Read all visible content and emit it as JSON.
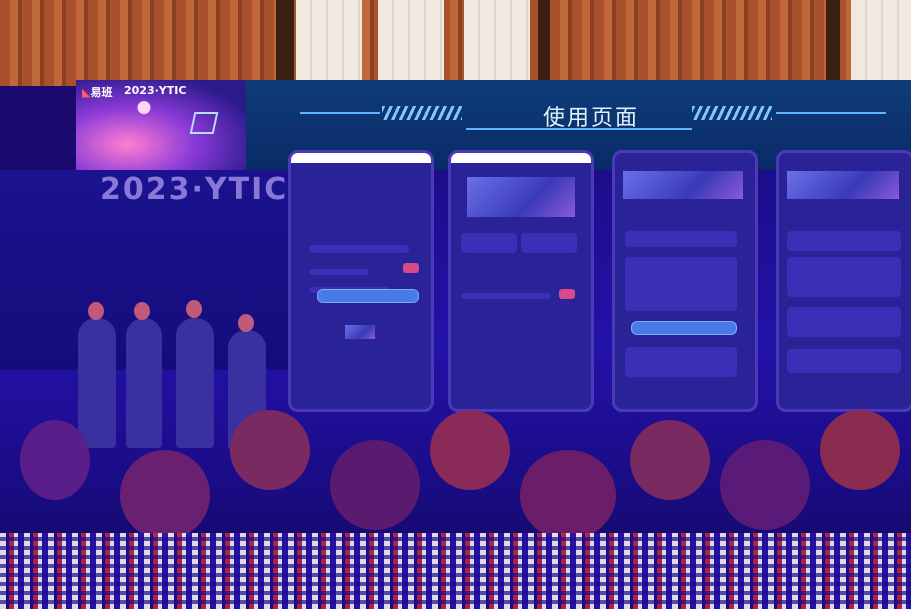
{
  "banner": {
    "logo": "易班",
    "event": "2023·YTIC"
  },
  "screen": {
    "title": "使用页面"
  },
  "backdrop": {
    "event": "2023·YTIC"
  },
  "colors": {
    "screen": "#0e3d7a",
    "accent": "#5fb4ff",
    "wall": "#a9512c"
  }
}
